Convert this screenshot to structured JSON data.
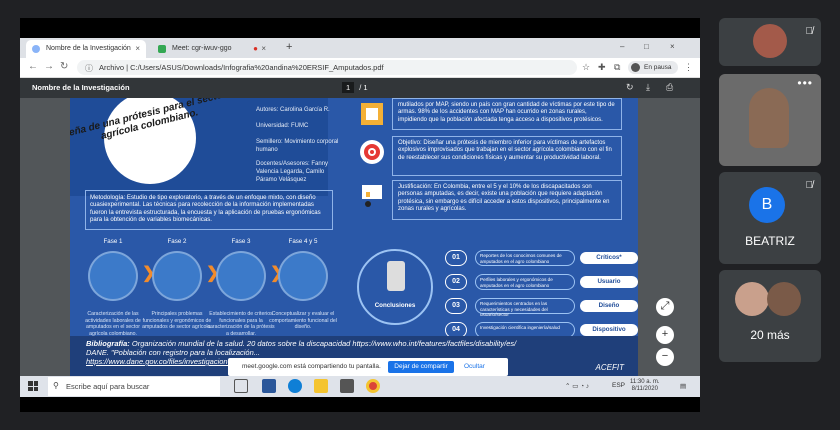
{
  "browser": {
    "tabs": [
      {
        "label": "Nombre de la Investigación",
        "close": "×"
      },
      {
        "label": "Meet: cgr-iwuv-ggo",
        "close": "×"
      }
    ],
    "new_tab": "+",
    "window_controls": [
      "–",
      "□",
      "×"
    ],
    "url": "Archivo | C:/Users/ASUS/Downloads/Infografia%20andina%20ERSIF_Amputados.pdf",
    "profile": "En pausa"
  },
  "pdf": {
    "title": "Nombre de la Investigación",
    "page_current": "1",
    "page_total": "/ 1"
  },
  "infographic": {
    "title_line1": "eña de una prótesis para el sector",
    "title_line2": "agrícola colombiano.",
    "authors": [
      "Autores: Carolina García R.",
      "Universidad: FUMC",
      "Semillero: Movimiento corporal humano",
      "Docentes/Asesores: Fanny Valencia Legarda, Camilo Páramo Velásquez"
    ],
    "methodology": "Metodología: Estudio de tipo exploratorio, a través de un enfoque mixto, con diseño cuasiexperimental. Las técnicas para recolección de la información implementadas fueron la entrevista estructurada, la encuesta y la aplicación de pruebas ergonómicas para la obtención de variables biomecánicas.",
    "problem": "mutilados por MAP, siendo un país con gran cantidad de víctimas por este tipo de armas. 98% de los accidentes con MAP han ocurrido en zonas rurales, impidiendo que la población afectada tenga acceso a dispositivos protésicos.",
    "objective": "Objetivo: Diseñar una prótesis de miembro inferior para víctimas de artefactos explosivos improvisados que trabajan en el sector agrícola colombiano con el fin de reestablecer sus condiciones físicas y aumentar su productividad laboral.",
    "justification": "Justificación: En Colombia, entre el 5 y el 10% de los discapacitados son personas amputadas, es decir, existe una población que requiere adaptación protésica, sin embargo es difícil acceder a estos dispositivos, principalmente en zonas rurales y agrícolas.",
    "phases": [
      {
        "name": "Fase 1",
        "desc": "Caracterización de las actividades laborales de amputados en el sector agrícola colombiano."
      },
      {
        "name": "Fase 2",
        "desc": "Principales problemas funcionales y ergonómicos de amputados de sector agrícola."
      },
      {
        "name": "Fase 3",
        "desc": "Establecimiento de criterios funcionales para la caracterización de la prótesis a desarrollar."
      },
      {
        "name": "Fase 4 y 5",
        "desc": "Conceptualizar y evaluar el comportamiento funcional del diseño."
      }
    ],
    "conclusions_label": "Conclusiones",
    "conclusions": [
      {
        "num": "01",
        "text": "Reportes de los conocimos comunes de amputados en el agro colombiano",
        "tag": "Críticos*"
      },
      {
        "num": "02",
        "text": "Perfiles laborales y ergonómicos de amputados en el agro colombiano",
        "tag": "Usuario"
      },
      {
        "num": "03",
        "text": "Requerimientos centrados en las características y necesidades del usuario/sector",
        "tag": "Diseño"
      },
      {
        "num": "04",
        "text": "Investigación científica ingeniería/salud",
        "tag": "Dispositivo"
      }
    ],
    "bibliography_title": "Bibliografía:",
    "bibliography_1": "Organización mundial de la salud. 20 datos sobre la discapacidad https://www.who.int/features/factfiles/disability/es/",
    "bibliography_2": "DANE. \"Población con registro para la localización...",
    "bibliography_3": "https://www.dane.gov.co/files/investigaciones...",
    "logo": "ACEFIT"
  },
  "share_notice": {
    "text": "meet.google.com está compartiendo tu pantalla.",
    "stop_label": "Dejar de compartir",
    "hide_label": "Ocultar"
  },
  "viewer_buttons": [
    "⤢",
    "+",
    "−"
  ],
  "taskbar": {
    "search_placeholder": "Escribe aquí para buscar",
    "lang": "ESP",
    "time": "11:30 a. m.",
    "date": "8/11/2020"
  },
  "participants": [
    {
      "name": "",
      "mic_off": true
    },
    {
      "name": "",
      "mic_off": false
    },
    {
      "name": "BEATRIZ",
      "initial": "B",
      "mic_off": true
    },
    {
      "name": "20 más"
    }
  ]
}
